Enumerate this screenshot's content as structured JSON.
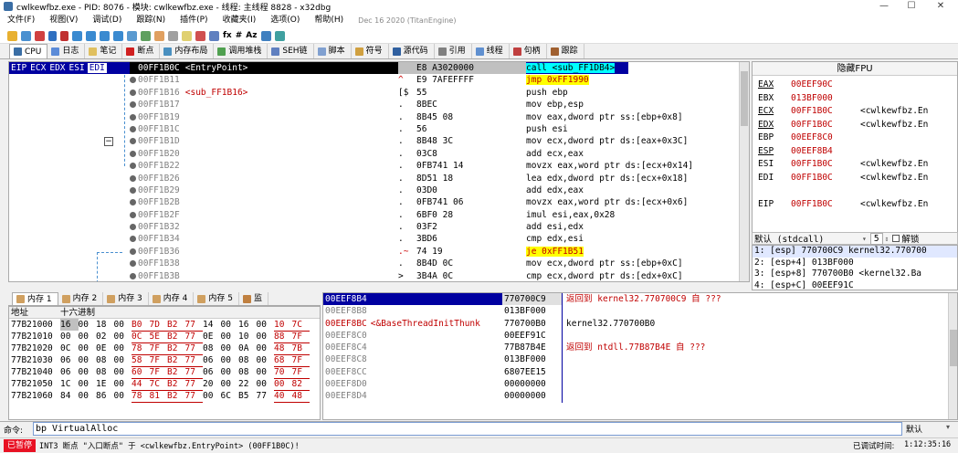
{
  "window": {
    "title": "cwlkewfbz.exe - PID: 8076 - 模块: cwlkewfbz.exe - 线程: 主线程 8828 - x32dbg",
    "min": "—",
    "max": "☐",
    "close": "✕"
  },
  "menu": {
    "items": [
      "文件(F)",
      "视图(V)",
      "调试(D)",
      "跟踪(N)",
      "插件(P)",
      "收藏夹(I)",
      "选项(O)",
      "帮助(H)"
    ],
    "date": "Dec 16 2020 (TitanEngine)"
  },
  "toolbar": {
    "fx": "fx",
    "hash": "#",
    "az": "Az"
  },
  "tabs": [
    {
      "label": "CPU",
      "color": "#3a6ea5"
    },
    {
      "label": "日志",
      "color": "#5b8bd8"
    },
    {
      "label": "笔记",
      "color": "#e0c060"
    },
    {
      "label": "断点",
      "color": "#d02020"
    },
    {
      "label": "内存布局",
      "color": "#4a90c0"
    },
    {
      "label": "调用堆栈",
      "color": "#50a050"
    },
    {
      "label": "SEH链",
      "color": "#6080c0"
    },
    {
      "label": "脚本",
      "color": "#80a0d0"
    },
    {
      "label": "符号",
      "color": "#d0a040"
    },
    {
      "label": "源代码",
      "color": "#3060a0"
    },
    {
      "label": "引用",
      "color": "#808080"
    },
    {
      "label": "线程",
      "color": "#6090d0"
    },
    {
      "label": "句柄",
      "color": "#c04040"
    },
    {
      "label": "跟踪",
      "color": "#a06030"
    }
  ],
  "cpu": {
    "regbar": [
      "EIP",
      "ECX",
      "EDX",
      "ESI",
      "EDI"
    ],
    "rows": [
      {
        "addr": "00FF1B0C",
        "label": "<EntryPoint>",
        "bytes": "E8 A3020000",
        "mark": "",
        "dis": "call <sub_FF1DB4>",
        "kind": "call"
      },
      {
        "addr": "00FF1B11",
        "label": "",
        "bytes": "E9 7AFEFFFF",
        "mark": "^",
        "dis": "jmp 0xFF1990",
        "kind": "jmp"
      },
      {
        "addr": "00FF1B16",
        "label": "<sub_FF1B16>",
        "bytes": "55",
        "mark": "[$",
        "dis": "push ebp",
        "kind": "plain"
      },
      {
        "addr": "00FF1B17",
        "label": "",
        "bytes": "8BEC",
        "mark": ".",
        "dis": "mov ebp,esp",
        "kind": "plain"
      },
      {
        "addr": "00FF1B19",
        "label": "",
        "bytes": "8B45 08",
        "mark": ".",
        "dis": "mov eax,dword ptr ss:[ebp+0x8]",
        "kind": "mem"
      },
      {
        "addr": "00FF1B1C",
        "label": "",
        "bytes": "56",
        "mark": ".",
        "dis": "push esi",
        "kind": "plain"
      },
      {
        "addr": "00FF1B1D",
        "label": "",
        "bytes": "8B48 3C",
        "mark": ".",
        "dis": "mov ecx,dword ptr ds:[eax+0x3C]",
        "kind": "mem"
      },
      {
        "addr": "00FF1B20",
        "label": "",
        "bytes": "03C8",
        "mark": ".",
        "dis": "add ecx,eax",
        "kind": "plain"
      },
      {
        "addr": "00FF1B22",
        "label": "",
        "bytes": "0FB741 14",
        "mark": ".",
        "dis": "movzx eax,word ptr ds:[ecx+0x14]",
        "kind": "mem"
      },
      {
        "addr": "00FF1B26",
        "label": "",
        "bytes": "8D51 18",
        "mark": ".",
        "dis": "lea edx,dword ptr ds:[ecx+0x18]",
        "kind": "mem"
      },
      {
        "addr": "00FF1B29",
        "label": "",
        "bytes": "03D0",
        "mark": ".",
        "dis": "add edx,eax",
        "kind": "plain"
      },
      {
        "addr": "00FF1B2B",
        "label": "",
        "bytes": "0FB741 06",
        "mark": ".",
        "dis": "movzx eax,word ptr ds:[ecx+0x6]",
        "kind": "mem"
      },
      {
        "addr": "00FF1B2F",
        "label": "",
        "bytes": "6BF0 28",
        "mark": ".",
        "dis": "imul esi,eax,0x28",
        "kind": "plain"
      },
      {
        "addr": "00FF1B32",
        "label": "",
        "bytes": "03F2",
        "mark": ".",
        "dis": "add esi,edx",
        "kind": "plain"
      },
      {
        "addr": "00FF1B34",
        "label": "",
        "bytes": "3BD6",
        "mark": ".",
        "dis": "cmp edx,esi",
        "kind": "plain"
      },
      {
        "addr": "00FF1B36",
        "label": "",
        "bytes": "74 19",
        "mark": ".~",
        "dis": "je 0xFF1B51",
        "kind": "je"
      },
      {
        "addr": "00FF1B38",
        "label": "",
        "bytes": "8B4D 0C",
        "mark": ".",
        "dis": "mov ecx,dword ptr ss:[ebp+0xC]",
        "kind": "mem"
      },
      {
        "addr": "00FF1B3B",
        "label": "",
        "bytes": "3B4A 0C",
        "mark": ">",
        "dis": "cmp ecx,dword ptr ds:[edx+0xC]",
        "kind": "mem"
      }
    ]
  },
  "fpu": {
    "title": "隐藏FPU",
    "regs": [
      {
        "name": "EAX",
        "value": "00EEF90C",
        "comment": "",
        "underline": true
      },
      {
        "name": "EBX",
        "value": "013BF000",
        "comment": "",
        "underline": false
      },
      {
        "name": "ECX",
        "value": "00FF1B0C",
        "comment": "<cwlkewfbz.En",
        "underline": true
      },
      {
        "name": "EDX",
        "value": "00FF1B0C",
        "comment": "<cwlkewfbz.En",
        "underline": true
      },
      {
        "name": "EBP",
        "value": "00EEF8C0",
        "comment": "",
        "underline": false
      },
      {
        "name": "ESP",
        "value": "00EEF8B4",
        "comment": "",
        "underline": true
      },
      {
        "name": "ESI",
        "value": "00FF1B0C",
        "comment": "<cwlkewfbz.En",
        "underline": false
      },
      {
        "name": "EDI",
        "value": "00FF1B0C",
        "comment": "<cwlkewfbz.En",
        "underline": false
      },
      {
        "name": "",
        "value": "",
        "comment": "",
        "underline": false
      },
      {
        "name": "EIP",
        "value": "00FF1B0C",
        "comment": "<cwlkewfbz.En",
        "underline": false
      }
    ]
  },
  "callconv": {
    "value": "默认 (stdcall)",
    "count": "5",
    "unlock": "解锁"
  },
  "stack_args": [
    "1: [esp] 770700C9 kernel32.770700",
    "2: [esp+4] 013BF000",
    "3: [esp+8] 770700B0 <kernel32.Ba",
    "4: [esp+C] 00EEF91C"
  ],
  "dump": {
    "tabs": [
      "内存 1",
      "内存 2",
      "内存 3",
      "内存 4",
      "内存 5",
      "监"
    ],
    "headers": [
      "地址",
      "十六进制"
    ],
    "rows": [
      {
        "addr": "77B21000",
        "hex": [
          "16",
          "00",
          "18",
          "00",
          "B0",
          "7D",
          "B2",
          "77",
          "14",
          "00",
          "16",
          "00",
          "10",
          "7C"
        ]
      },
      {
        "addr": "77B21010",
        "hex": [
          "00",
          "00",
          "02",
          "00",
          "0C",
          "5E",
          "B2",
          "77",
          "0E",
          "00",
          "10",
          "00",
          "88",
          "7F"
        ]
      },
      {
        "addr": "77B21020",
        "hex": [
          "0C",
          "00",
          "0E",
          "00",
          "78",
          "7F",
          "B2",
          "77",
          "08",
          "00",
          "0A",
          "00",
          "48",
          "7B"
        ]
      },
      {
        "addr": "77B21030",
        "hex": [
          "06",
          "00",
          "08",
          "00",
          "58",
          "7F",
          "B2",
          "77",
          "06",
          "00",
          "08",
          "00",
          "68",
          "7F"
        ]
      },
      {
        "addr": "77B21040",
        "hex": [
          "06",
          "00",
          "08",
          "00",
          "60",
          "7F",
          "B2",
          "77",
          "06",
          "00",
          "08",
          "00",
          "70",
          "7F"
        ]
      },
      {
        "addr": "77B21050",
        "hex": [
          "1C",
          "00",
          "1E",
          "00",
          "44",
          "7C",
          "B2",
          "77",
          "20",
          "00",
          "22",
          "00",
          "00",
          "82"
        ]
      },
      {
        "addr": "77B21060",
        "hex": [
          "84",
          "00",
          "86",
          "00",
          "78",
          "81",
          "B2",
          "77",
          "00",
          "6C",
          "B5",
          "77",
          "40",
          "48"
        ]
      }
    ]
  },
  "stack": {
    "rows": [
      {
        "addr": "00EEF8B4",
        "label": "",
        "value": "770700C9",
        "comment": "返回到 kernel32.770700C9 自 ???",
        "sel": true
      },
      {
        "addr": "00EEF8B8",
        "label": "",
        "value": "013BF000",
        "comment": "",
        "sel": false
      },
      {
        "addr": "00EEF8BC",
        "label": "<&BaseThreadInitThunk",
        "value": "770700B0",
        "comment": "kernel32.770700B0",
        "sel": false
      },
      {
        "addr": "00EEF8C0",
        "label": "",
        "value": "00EEF91C",
        "comment": "",
        "sel": false
      },
      {
        "addr": "00EEF8C4",
        "label": "",
        "value": "77B87B4E",
        "comment": "返回到 ntdll.77B87B4E 自 ???",
        "sel": false
      },
      {
        "addr": "00EEF8C8",
        "label": "",
        "value": "013BF000",
        "comment": "",
        "sel": false
      },
      {
        "addr": "00EEF8CC",
        "label": "",
        "value": "6807EE15",
        "comment": "",
        "sel": false
      },
      {
        "addr": "00EEF8D0",
        "label": "",
        "value": "00000000",
        "comment": "",
        "sel": false
      },
      {
        "addr": "00EEF8D4",
        "label": "",
        "value": "00000000",
        "comment": "",
        "sel": false
      }
    ]
  },
  "command": {
    "label": "命令:",
    "value": "bp VirtualAlloc",
    "mode": "默认"
  },
  "status": {
    "paused": "已暂停",
    "message": "INT3 断点 \"入口断点\" 于 <cwlkewfbz.EntryPoint> (00FF1B0C)!",
    "elapsed_label": "已调试时间:",
    "elapsed": "1:12:35:16"
  }
}
